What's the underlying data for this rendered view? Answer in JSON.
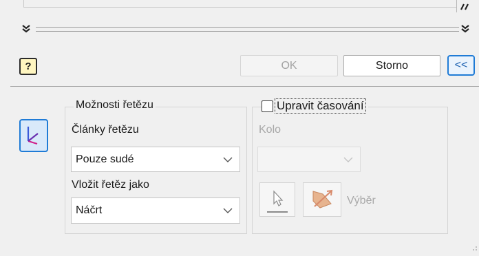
{
  "dialog": {
    "help_symbol": "?",
    "ok_label": "OK",
    "cancel_label": "Storno",
    "collapse_label": "<<"
  },
  "chain_options": {
    "title": "Možnosti řetězu",
    "links_label": "Články řetězu",
    "links_value": "Pouze sudé",
    "insert_label": "Vložit řetěz jako",
    "insert_value": "Náčrt"
  },
  "timing": {
    "checkbox_label": "Upravit časování",
    "checked": false,
    "round_label": "Kolo",
    "round_value": "",
    "selection_label": "Výběr"
  },
  "colors": {
    "accent": "#1f7bd6",
    "disabled_text": "#a8a8a8"
  }
}
